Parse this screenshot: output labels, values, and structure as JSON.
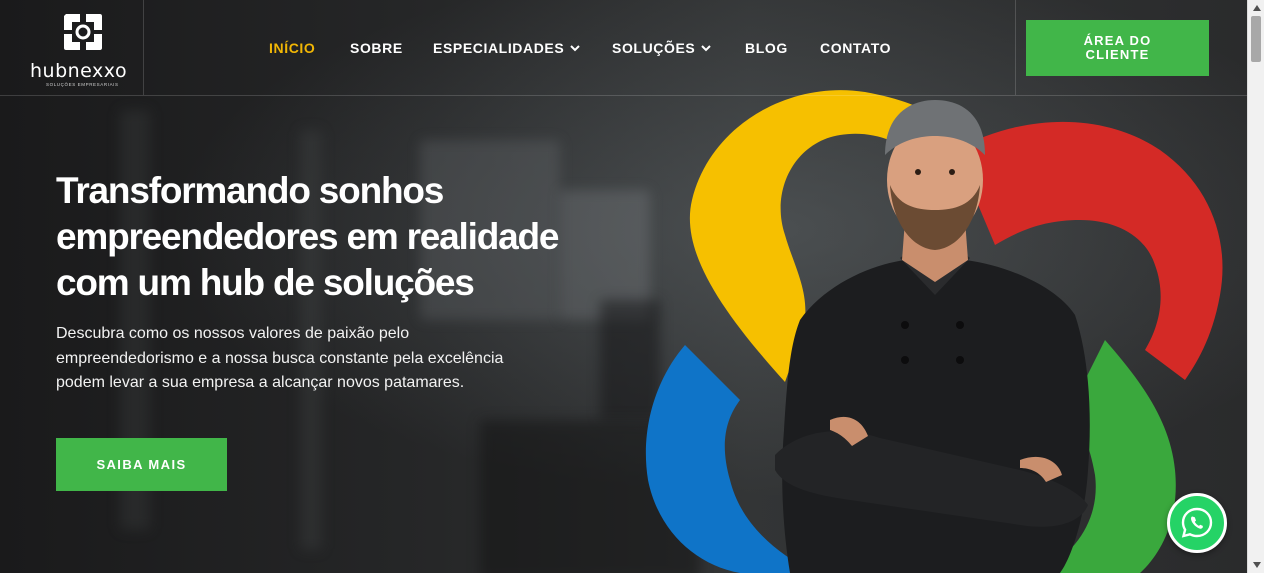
{
  "brand": {
    "name": "hubnexxo",
    "tagline": "SOLUÇÕES EMPRESARIAIS"
  },
  "nav": {
    "items": [
      {
        "label": "INÍCIO",
        "active": true
      },
      {
        "label": "SOBRE"
      },
      {
        "label": "ESPECIALIDADES",
        "dropdown": true
      },
      {
        "label": "SOLUÇÕES",
        "dropdown": true
      },
      {
        "label": "BLOG"
      },
      {
        "label": "CONTATO"
      }
    ],
    "client_button": "ÁREA DO CLIENTE"
  },
  "hero": {
    "title": "Transformando sonhos empreendedores em realidade com um hub de soluções",
    "description": "Descubra como os nossos valores de paixão pelo empreendedorismo e a nossa busca constante pela excelência podem levar a sua empresa a alcançar novos patamares.",
    "cta": "SAIBA MAIS"
  },
  "colors": {
    "accent_green": "#41b649",
    "active_nav": "#f2b705",
    "shape_yellow": "#f6c000",
    "shape_red": "#d42a26",
    "shape_blue": "#0f74c8",
    "shape_green": "#3aa83d",
    "whatsapp": "#25d366"
  },
  "icons": {
    "logo": "hubnexxo-logo-icon",
    "dropdown": "chevron-down-icon",
    "whatsapp": "whatsapp-icon"
  }
}
